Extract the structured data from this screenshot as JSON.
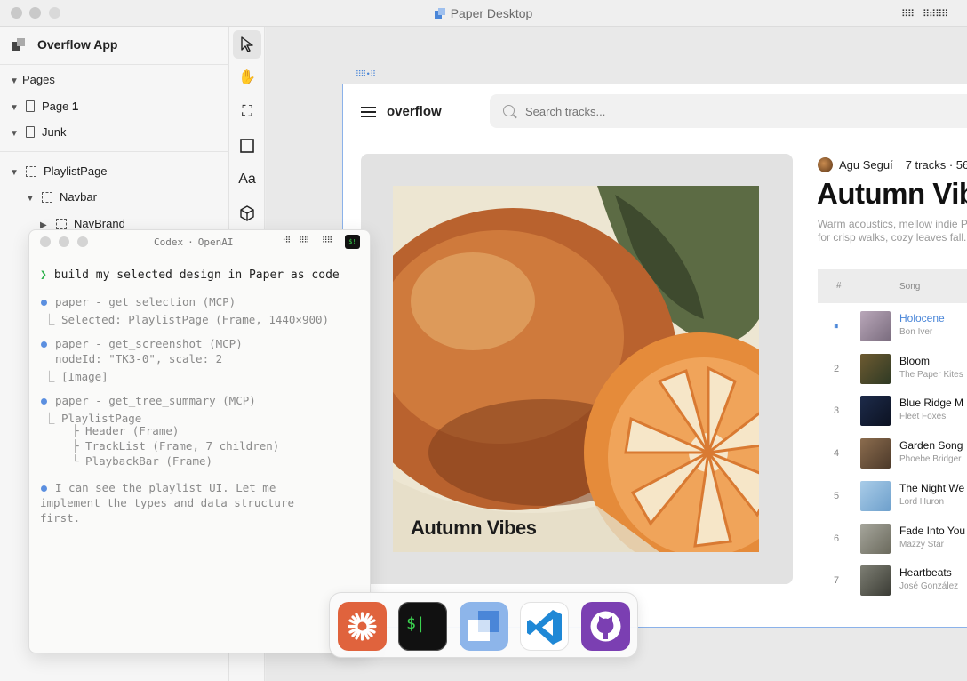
{
  "window": {
    "title": "Paper Desktop"
  },
  "sidebar": {
    "project": "Overflow App",
    "pages_label": "Pages",
    "pages": [
      {
        "name": "Page ",
        "badge": "1"
      },
      {
        "name": "Junk",
        "badge": ""
      }
    ],
    "layers": [
      {
        "name": "PlaylistPage"
      },
      {
        "name": "Navbar"
      },
      {
        "name": "NavBrand"
      }
    ]
  },
  "tools": [
    {
      "name": "select-tool",
      "glyph": "➤"
    },
    {
      "name": "hand-tool",
      "glyph": "✋"
    },
    {
      "name": "frame-tool",
      "glyph": "⛶"
    },
    {
      "name": "rectangle-tool",
      "glyph": "▭"
    },
    {
      "name": "text-tool",
      "glyph": "Aa"
    },
    {
      "name": "component-tool",
      "glyph": "⬡"
    }
  ],
  "design": {
    "frame_label": "⠿⠿ • ⠿",
    "brand": "overflow",
    "search_placeholder": "Search tracks...",
    "artwork_title": "Autumn Vibes",
    "author": "Agu Seguí",
    "track_summary": "7 tracks · 56",
    "playlist_title": "Autumn Vib",
    "description": "Warm acoustics, mellow indie Perfect for crisp walks, cozy leaves fall.",
    "table_headers": {
      "number": "#",
      "song": "Song"
    },
    "tracks": [
      {
        "num": "⏸",
        "title": "Holocene",
        "artist": "Bon Iver",
        "playing": true,
        "color1": "#b9a7b9",
        "color2": "#7a6c7e"
      },
      {
        "num": "2",
        "title": "Bloom",
        "artist": "The Paper Kites",
        "playing": false,
        "color1": "#6d5a31",
        "color2": "#2f3a24"
      },
      {
        "num": "3",
        "title": "Blue Ridge M",
        "artist": "Fleet Foxes",
        "playing": false,
        "color1": "#1d2b4a",
        "color2": "#0c1222"
      },
      {
        "num": "4",
        "title": "Garden Song",
        "artist": "Phoebe Bridger",
        "playing": false,
        "color1": "#8b6c4e",
        "color2": "#4d3a2a"
      },
      {
        "num": "5",
        "title": "The Night We",
        "artist": "Lord Huron",
        "playing": false,
        "color1": "#a9cce8",
        "color2": "#6ea0cc"
      },
      {
        "num": "6",
        "title": "Fade Into You",
        "artist": "Mazzy Star",
        "playing": false,
        "color1": "#a6a69c",
        "color2": "#6b6a5d"
      },
      {
        "num": "7",
        "title": "Heartbeats",
        "artist": "José González",
        "playing": false,
        "color1": "#7e7f74",
        "color2": "#3b3c35"
      }
    ]
  },
  "codex": {
    "title": "Codex",
    "separator": "·",
    "vendor": "OpenAI",
    "prompt_char": "❯",
    "prompt": "build my selected design in Paper as code",
    "lines": [
      "paper - get_selection (MCP)",
      "⎿  Selected: PlaylistPage (Frame, 1440×900)",
      "paper - get_screenshot (MCP)",
      "nodeId: \"TK3-0\", scale: 2",
      "⎿  [Image]",
      "paper - get_tree_summary (MCP)",
      "⎿  PlaylistPage",
      "├ Header (Frame)",
      "├ TrackList (Frame, 7 children)",
      "└ PlaybackBar (Frame)",
      "I can see the playlist UI. Let me",
      "implement the types and data structure",
      "first."
    ]
  },
  "dock": [
    {
      "name": "claude-app-icon",
      "color": "#e0633d"
    },
    {
      "name": "terminal-app-icon",
      "color": "#111111"
    },
    {
      "name": "paper-app-icon",
      "color": "#6f9ee0"
    },
    {
      "name": "vscode-app-icon",
      "color": "#ffffff"
    },
    {
      "name": "github-desktop-app-icon",
      "color": "#7b3fb2"
    }
  ]
}
